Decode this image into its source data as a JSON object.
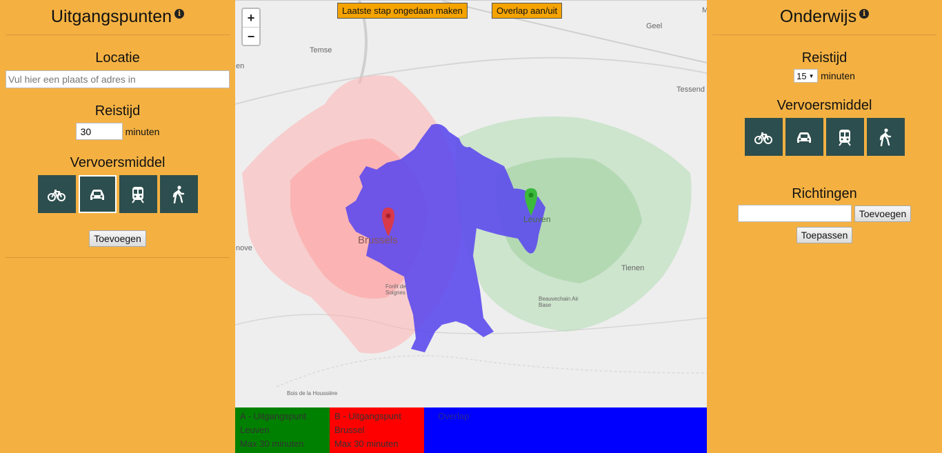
{
  "left": {
    "title": "Uitgangspunten",
    "location_title": "Locatie",
    "location_placeholder": "Vul hier een plaats of adres in",
    "travel_title": "Reistijd",
    "travel_value": "30",
    "minutes_label": "minuten",
    "mode_title": "Vervoersmiddel",
    "add_label": "Toevoegen",
    "active_mode": "car"
  },
  "right": {
    "title": "Onderwijs",
    "travel_title": "Reistijd",
    "travel_select": "15",
    "minutes_label": "minuten",
    "mode_title": "Vervoersmiddel",
    "directions_title": "Richtingen",
    "add_label": "Toevoegen",
    "apply_label": "Toepassen"
  },
  "map": {
    "undo_label": "Laatste stap ongedaan maken",
    "overlap_label": "Overlap aan/uit",
    "zoom_in": "+",
    "zoom_out": "−",
    "places": {
      "temse": "Temse",
      "geel": "Geel",
      "tessend": "Tessend",
      "brussels": "Brussels",
      "leuven": "Leuven",
      "tienen": "Tienen",
      "foret": "Forêt de Soignes",
      "beauvechain": "Beauvechain Air Base",
      "houssiere": "Bois de la Houssière",
      "nove": "nove",
      "en": "en",
      "m": "M"
    },
    "colors": {
      "red_area": "#ff9999",
      "green_area": "#a8d8a8",
      "overlap": "#6a5cf0"
    }
  },
  "legend": {
    "a_line1": "A - Uitgangspunt",
    "a_line2": "Leuven",
    "a_line3": "Max 30 minuten",
    "b_line1": "B - Uitgangspunt",
    "b_line2": "Brussel",
    "b_line3": "Max 30 minuten",
    "c_line1": "Overlap"
  }
}
